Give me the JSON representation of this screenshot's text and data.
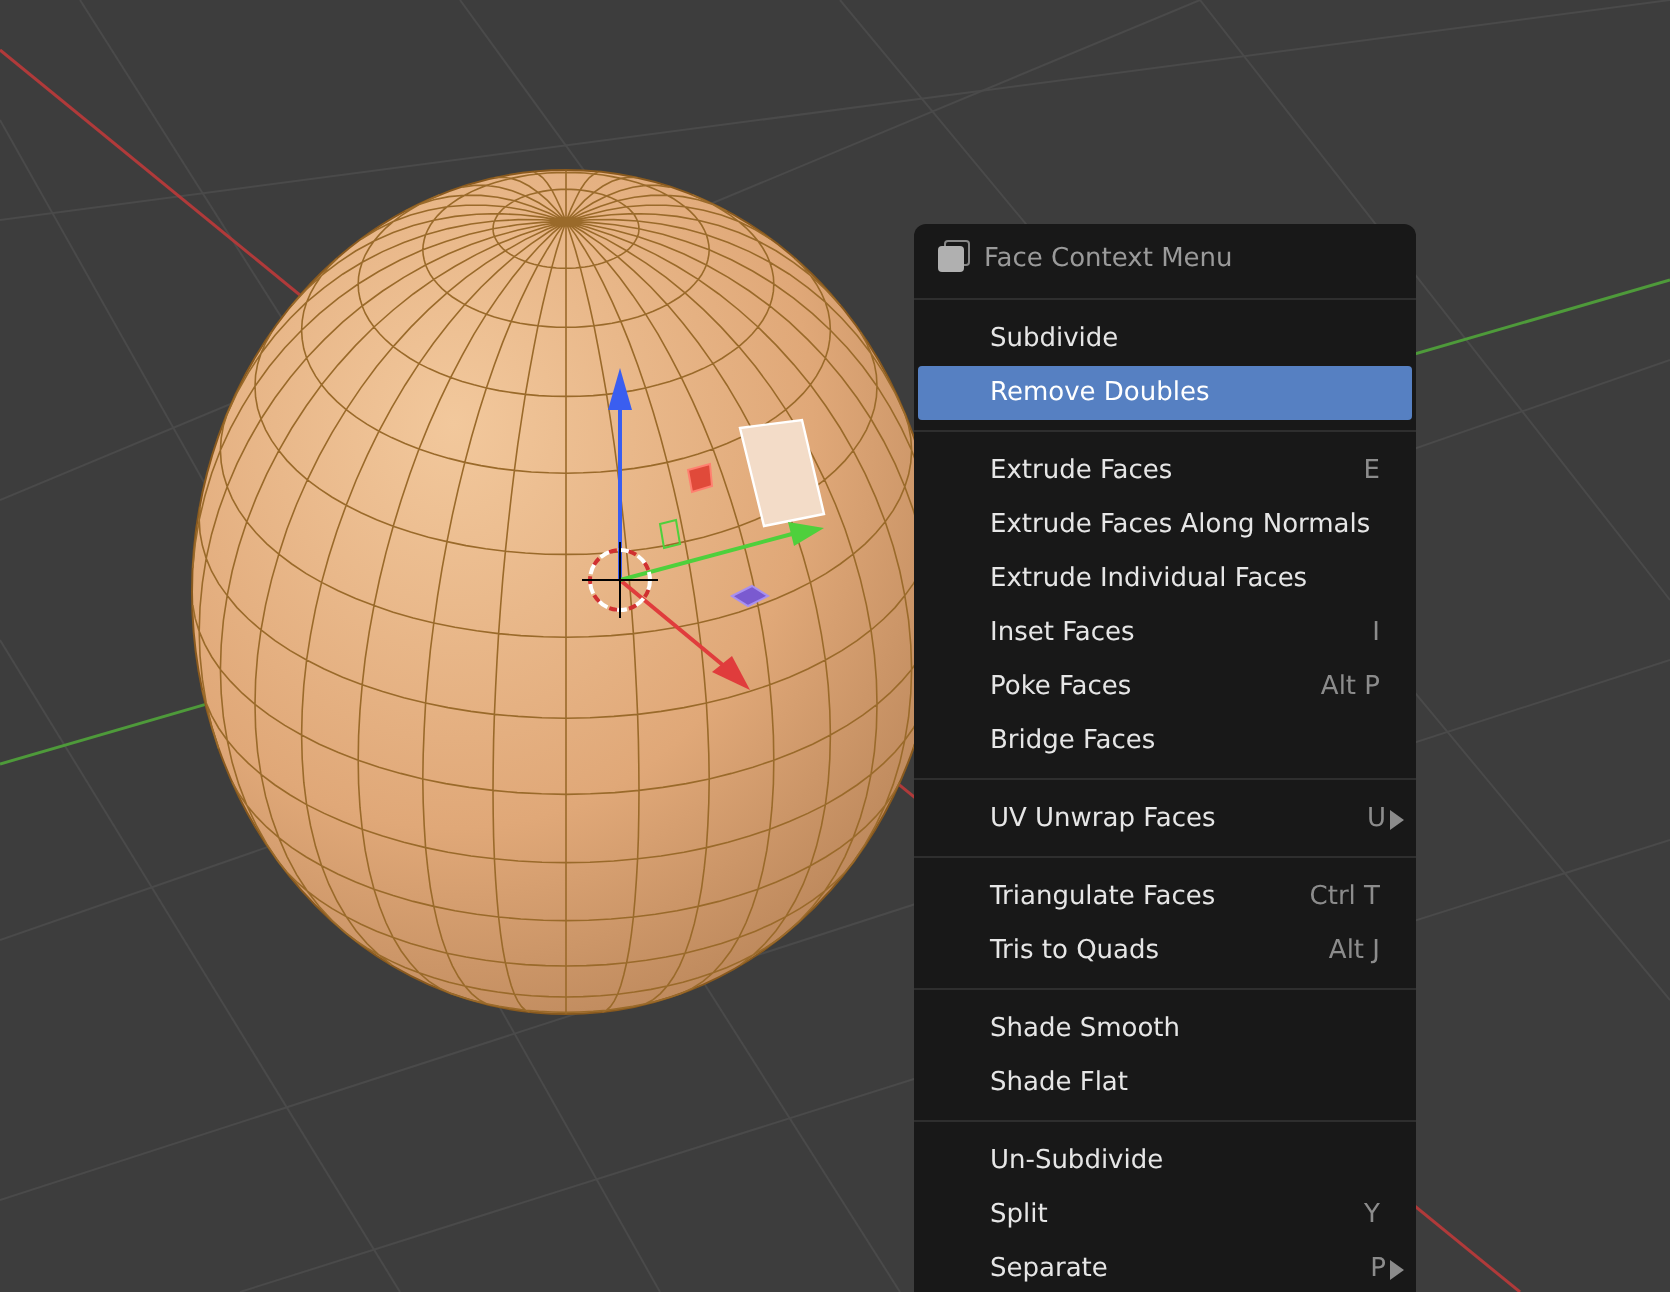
{
  "context_menu": {
    "title": "Face Context Menu",
    "sections": [
      {
        "items": [
          {
            "label": "Subdivide",
            "submenu": false,
            "selected": false
          },
          {
            "label": "Remove Doubles",
            "submenu": false,
            "selected": true
          }
        ]
      },
      {
        "items": [
          {
            "label": "Extrude Faces",
            "shortcut": "E",
            "submenu": false,
            "selected": false
          },
          {
            "label": "Extrude Faces Along Normals",
            "submenu": false,
            "selected": false
          },
          {
            "label": "Extrude Individual Faces",
            "submenu": false,
            "selected": false
          },
          {
            "label": "Inset Faces",
            "shortcut": "I",
            "submenu": false,
            "selected": false
          },
          {
            "label": "Poke Faces",
            "shortcut": "Alt P",
            "submenu": false,
            "selected": false
          },
          {
            "label": "Bridge Faces",
            "submenu": false,
            "selected": false
          }
        ]
      },
      {
        "items": [
          {
            "label": "UV Unwrap Faces",
            "shortcut": "U",
            "submenu": true,
            "selected": false
          }
        ]
      },
      {
        "items": [
          {
            "label": "Triangulate Faces",
            "shortcut": "Ctrl T",
            "submenu": false,
            "selected": false
          },
          {
            "label": "Tris to Quads",
            "shortcut": "Alt J",
            "submenu": false,
            "selected": false
          }
        ]
      },
      {
        "items": [
          {
            "label": "Shade Smooth",
            "submenu": false,
            "selected": false
          },
          {
            "label": "Shade Flat",
            "submenu": false,
            "selected": false
          }
        ]
      },
      {
        "items": [
          {
            "label": "Un-Subdivide",
            "submenu": false,
            "selected": false
          },
          {
            "label": "Split",
            "shortcut": "Y",
            "submenu": false,
            "selected": false
          },
          {
            "label": "Separate",
            "shortcut": "P",
            "submenu": true,
            "selected": false
          }
        ]
      }
    ]
  }
}
